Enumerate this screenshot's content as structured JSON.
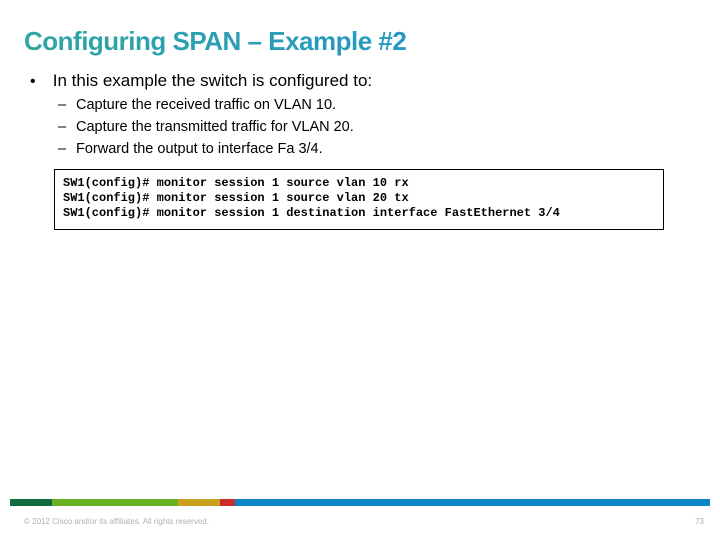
{
  "title": "Configuring SPAN – Example #2",
  "intro": "In this example the switch is configured to:",
  "bullets": [
    "Capture the received traffic on VLAN 10.",
    "Capture the transmitted traffic for VLAN 20.",
    "Forward the output to interface Fa 3/4."
  ],
  "code": [
    "SW1(config)# monitor session 1 source vlan 10 rx",
    "SW1(config)# monitor session 1 source vlan 20 tx",
    "SW1(config)# monitor session 1 destination interface FastEthernet 3/4"
  ],
  "footer": {
    "copyright": "© 2012 Cisco and/or its affiliates. All rights reserved.",
    "page": "73"
  }
}
